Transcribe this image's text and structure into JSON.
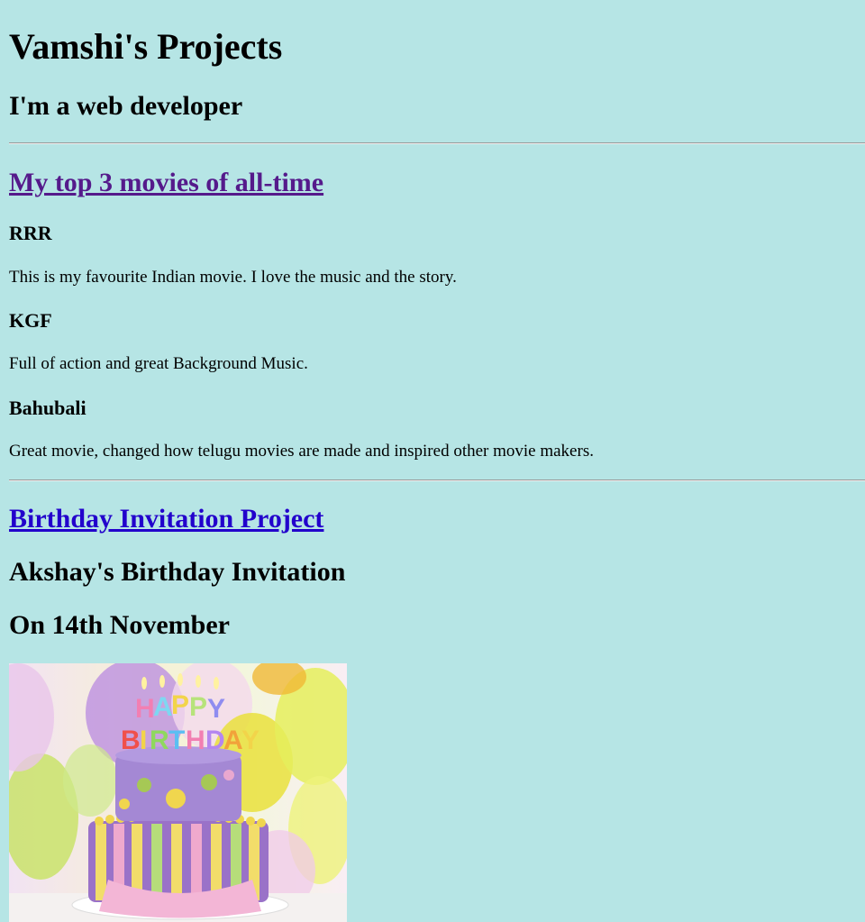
{
  "header": {
    "title": "Vamshi's Projects",
    "subtitle": "I'm a web developer"
  },
  "movies_section": {
    "link_label": "My top 3 movies of all-time",
    "movies": [
      {
        "title": "RRR",
        "description": "This is my favourite Indian movie. I love the music and the story."
      },
      {
        "title": "KGF",
        "description": "Full of action and great Background Music."
      },
      {
        "title": "Bahubali",
        "description": "Great movie, changed how telugu movies are made and inspired other movie makers."
      }
    ]
  },
  "birthday_section": {
    "link_label": "Birthday Invitation Project",
    "invitation_title": "Akshay's Birthday Invitation",
    "invitation_date": "On 14th November",
    "image": {
      "name": "birthday-cake-image",
      "candle_text_line1": "HAPPY",
      "candle_text_line2": "BIRTHDAY"
    }
  },
  "colors": {
    "background": "#b6e5e5",
    "visited_link": "#551a8b",
    "unvisited_link": "#2200cc"
  }
}
